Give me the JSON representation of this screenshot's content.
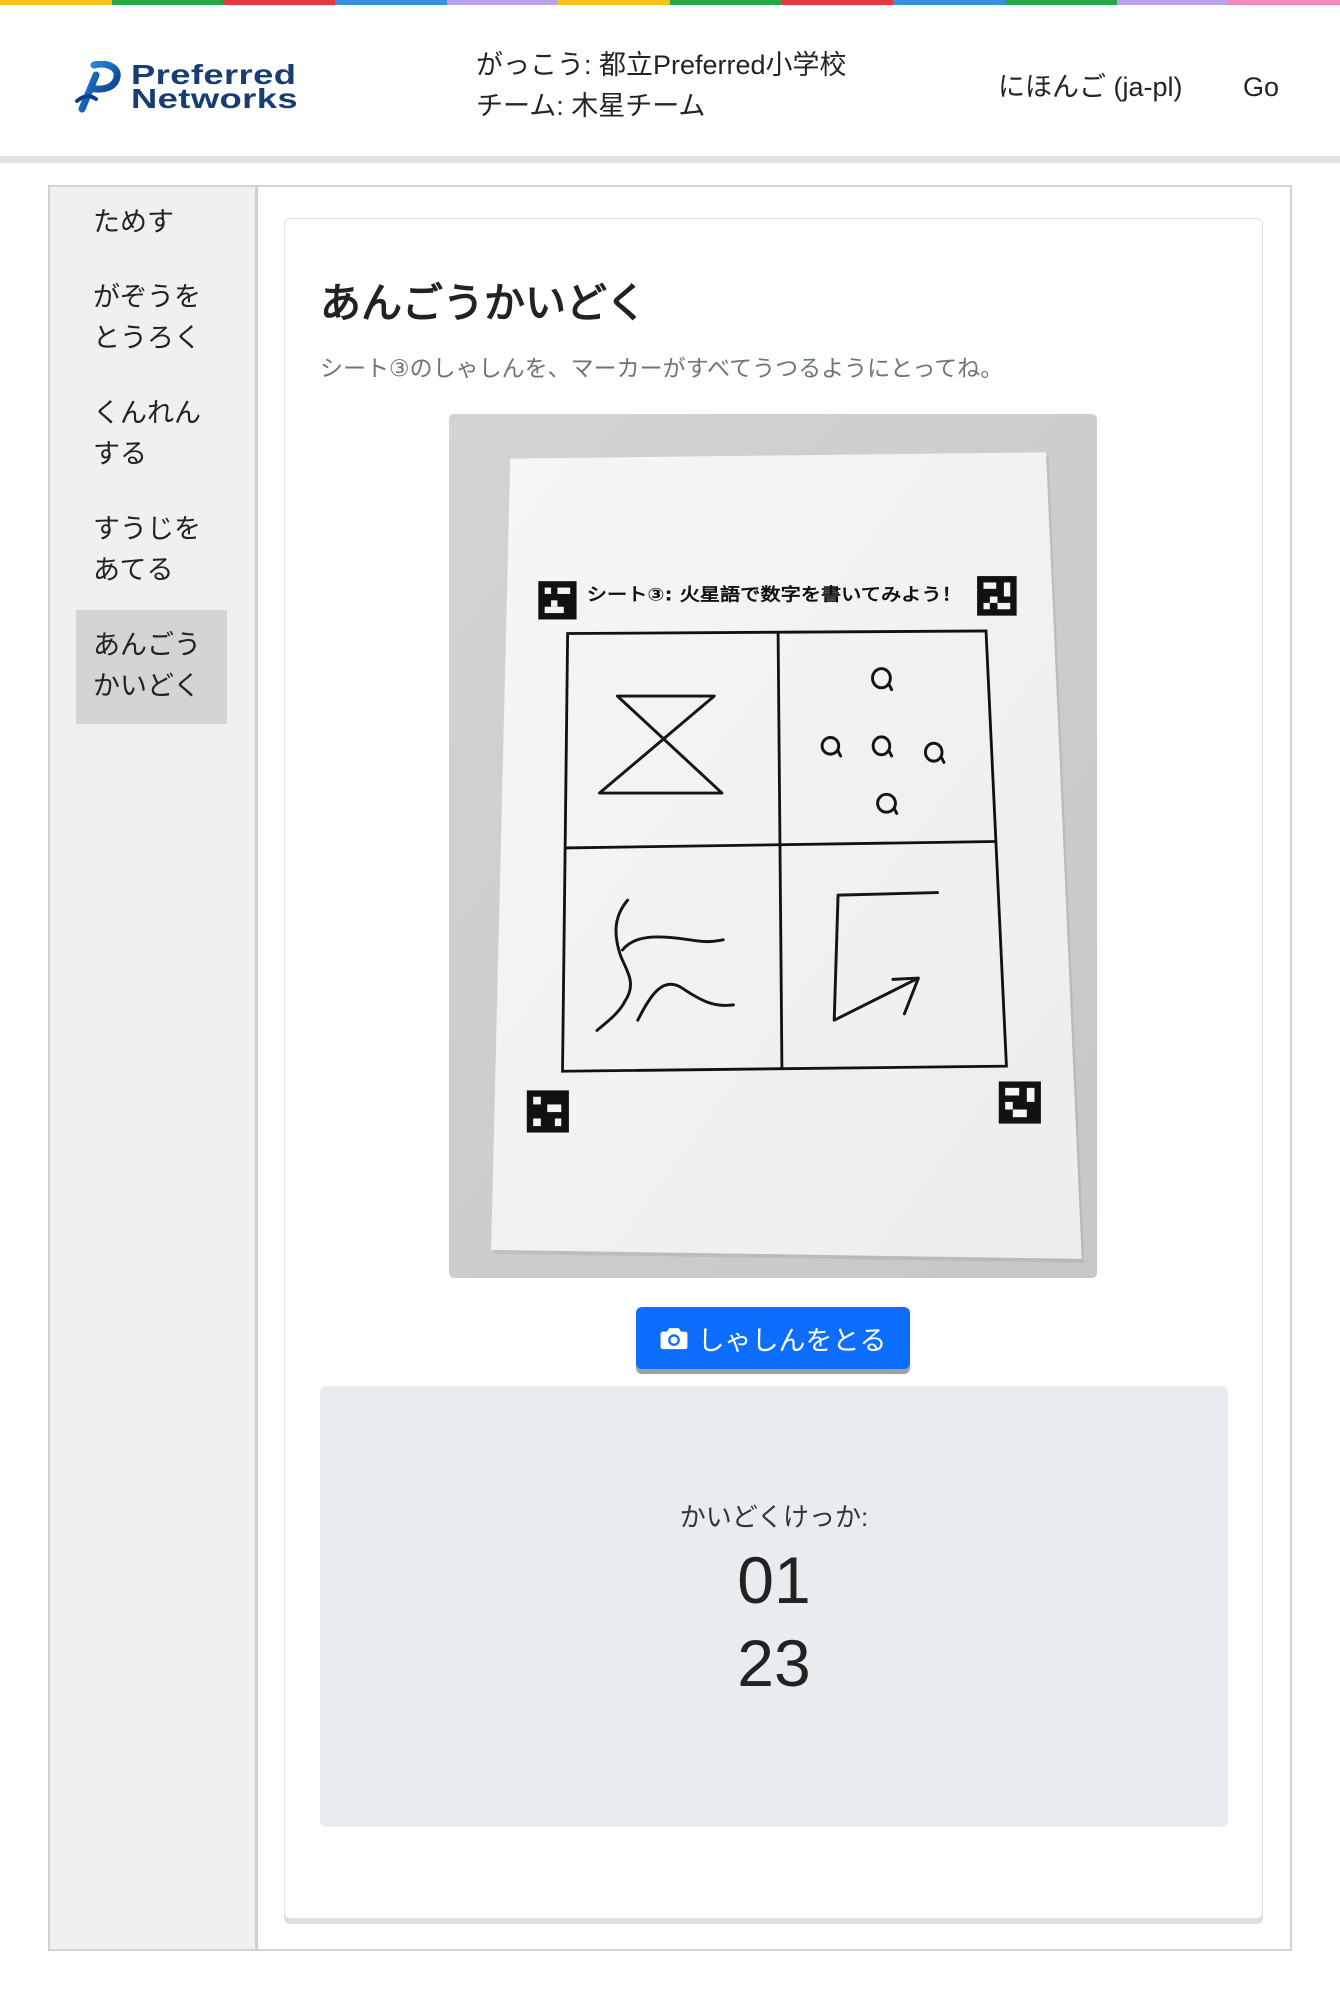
{
  "theme": {
    "primary": "#0d6efd",
    "sidebar_bg": "#f0f0f0",
    "active_item_bg": "#d4d4d4",
    "result_bg": "#e9ecef",
    "logo_text": "#173d72",
    "muted_text": "#6c757d"
  },
  "header": {
    "stripe_colors": [
      "#f5c518",
      "#27a744",
      "#e5383b",
      "#3b8ee0",
      "#b9a3ee",
      "#f5c518",
      "#27a744",
      "#e5383b",
      "#3b8ee0",
      "#27a744",
      "#b9a3ee",
      "#f08bb8"
    ],
    "logo": {
      "icon": "pfn-logo-icon",
      "line1": "Preferred",
      "line2": "Networks"
    },
    "school": "がっこう: 都立Preferred小学校",
    "team": "チーム: 木星チーム",
    "language": "にほんご (ja-pl)",
    "go": "Go"
  },
  "sidebar": {
    "active_index": 4,
    "items": [
      {
        "lines": [
          "ためす"
        ]
      },
      {
        "lines": [
          "がぞうを",
          "とうろく"
        ]
      },
      {
        "lines": [
          "くんれん",
          "する"
        ]
      },
      {
        "lines": [
          "すうじを",
          "あてる"
        ]
      },
      {
        "lines": [
          "あんごう",
          "かいどく"
        ]
      }
    ]
  },
  "main": {
    "title": "あんごうかいどく",
    "instruction": "シート③のしゃしんを、マーカーがすべてうつるようにとってね。",
    "photo": {
      "sheet_title": "シート③: 火星語で数字を書いてみよう！"
    },
    "capture_button": {
      "icon": "camera-icon",
      "label": "しゃしんをとる"
    },
    "result": {
      "label": "かいどくけっか:",
      "lines": [
        "01",
        "23"
      ]
    }
  }
}
